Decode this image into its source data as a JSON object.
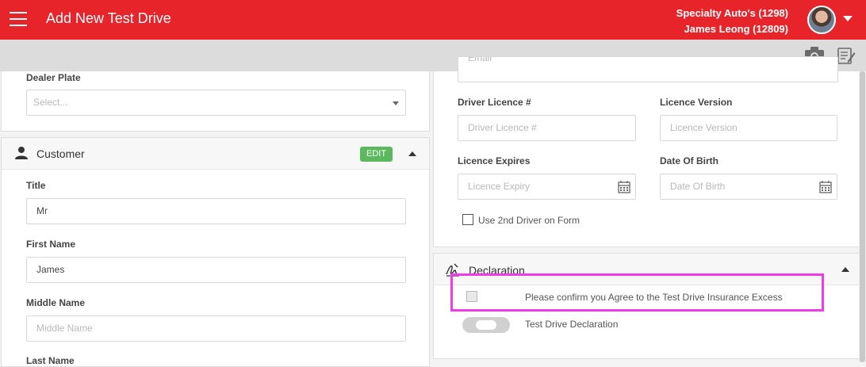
{
  "header": {
    "title": "Add New Test Drive",
    "dealer": "Specialty Auto's (1298)",
    "user": "James Leong (12809)",
    "menu_icon": "hamburger-menu-icon",
    "avatar_icon": "user-avatar",
    "dropdown_icon": "caret-down-icon",
    "color": "#e8242b"
  },
  "toolbar": {
    "camera_icon": "camera-icon",
    "notes_icon": "edit-notes-icon"
  },
  "dealer_plate": {
    "label": "Dealer Plate",
    "placeholder": "Select..."
  },
  "customer": {
    "section_title": "Customer",
    "edit_label": "EDIT",
    "icon": "person-icon",
    "fields": {
      "title": {
        "label": "Title",
        "value": "Mr"
      },
      "first_name": {
        "label": "First Name",
        "value": "James"
      },
      "middle_name": {
        "label": "Middle Name",
        "placeholder": "Middle Name"
      },
      "last_name": {
        "label": "Last Name"
      }
    }
  },
  "driver": {
    "email_placeholder": "Email",
    "licence_number": {
      "label": "Driver Licence #",
      "placeholder": "Driver Licence #"
    },
    "licence_version": {
      "label": "Licence Version",
      "placeholder": "Licence Version"
    },
    "licence_expires": {
      "label": "Licence Expires",
      "placeholder": "Licence Expiry"
    },
    "date_of_birth": {
      "label": "Date Of Birth",
      "placeholder": "Date Of Birth"
    },
    "second_driver_label": "Use 2nd Driver on Form"
  },
  "declaration": {
    "section_title": "Declaration",
    "icon": "signature-icon",
    "agree_text": "Please confirm you Agree to the Test Drive Insurance Excess",
    "toggle_label": "Test Drive Declaration",
    "highlight_color": "#f03ce8"
  }
}
